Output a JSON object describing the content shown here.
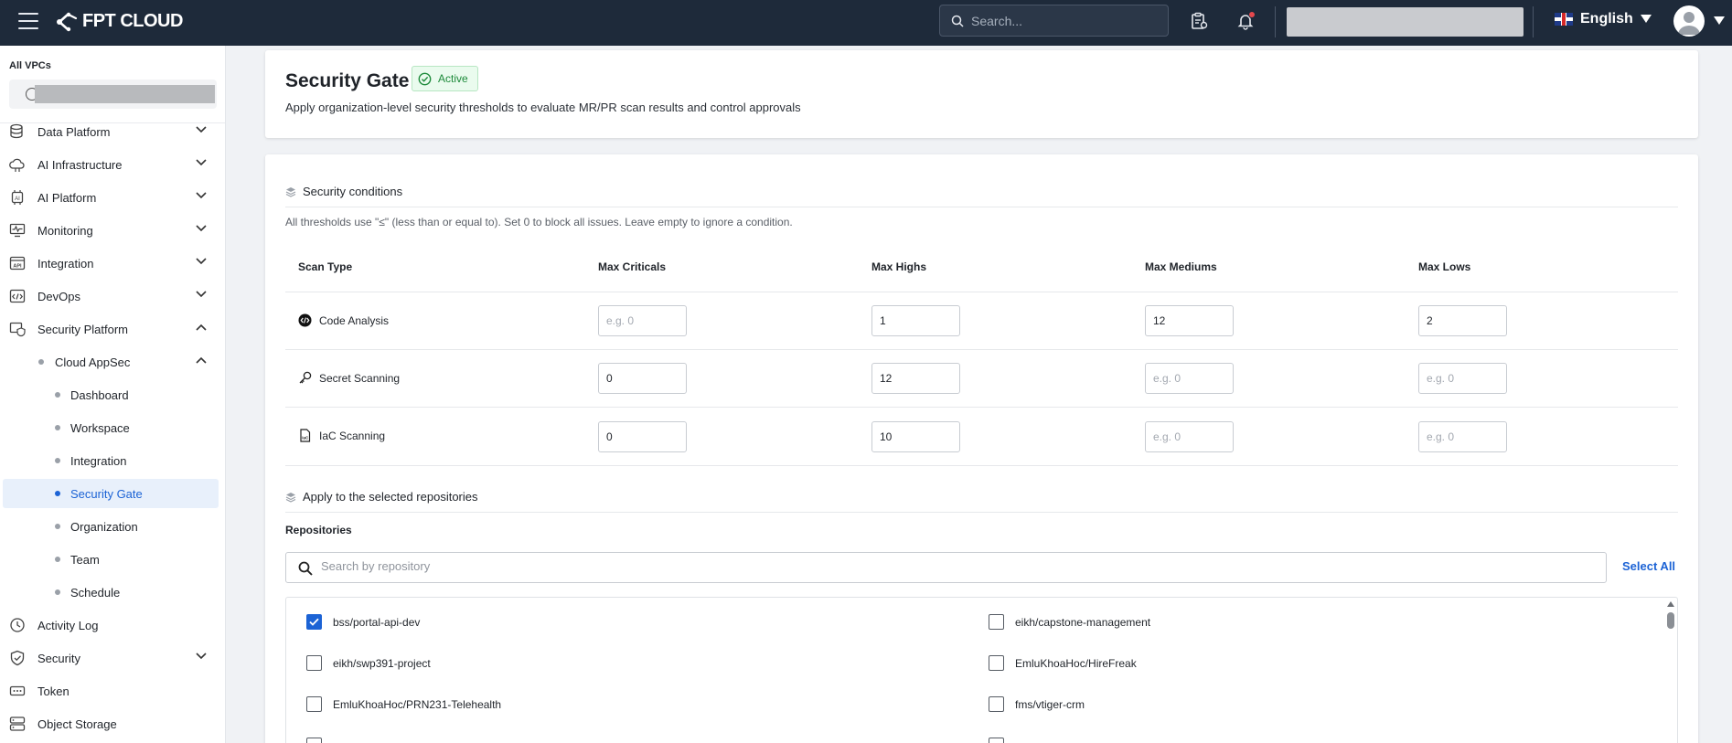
{
  "topbar": {
    "brand": "FPT CLOUD",
    "search_placeholder": "Search...",
    "language": "English"
  },
  "sidebar": {
    "vpc_label": "All VPCs",
    "items": [
      {
        "label": "Data Platform",
        "icon": "database-icon"
      },
      {
        "label": "AI Infrastructure",
        "icon": "cloud-ai-icon"
      },
      {
        "label": "AI Platform",
        "icon": "ai-chip-icon"
      },
      {
        "label": "Monitoring",
        "icon": "monitor-icon"
      },
      {
        "label": "Integration",
        "icon": "api-icon"
      },
      {
        "label": "DevOps",
        "icon": "code-window-icon"
      },
      {
        "label": "Security Platform",
        "icon": "shield-settings-icon"
      }
    ],
    "cloud_appsec": "Cloud AppSec",
    "sub_items": [
      "Dashboard",
      "Workspace",
      "Integration",
      "Security Gate",
      "Organization",
      "Team",
      "Schedule"
    ],
    "bottom_items": [
      {
        "label": "Activity Log",
        "icon": "clock-icon"
      },
      {
        "label": "Security",
        "icon": "shield-check-icon"
      },
      {
        "label": "Token",
        "icon": "token-icon"
      },
      {
        "label": "Object Storage",
        "icon": "storage-icon"
      }
    ]
  },
  "header": {
    "title": "Security Gate",
    "status": "Active",
    "description": "Apply organization-level security thresholds to evaluate MR/PR scan results and control approvals"
  },
  "conditions": {
    "title": "Security conditions",
    "note": "All thresholds use \"≤\" (less than or equal to). Set 0 to block all issues. Leave empty to ignore a condition.",
    "columns": [
      "Scan Type",
      "Max Criticals",
      "Max Highs",
      "Max Mediums",
      "Max Lows"
    ],
    "placeholder": "e.g. 0",
    "rows": [
      {
        "name": "Code Analysis",
        "icon": "code-icon",
        "values": [
          "",
          "1",
          "12",
          "2"
        ]
      },
      {
        "name": "Secret Scanning",
        "icon": "key-icon",
        "values": [
          "0",
          "12",
          "",
          ""
        ]
      },
      {
        "name": "IaC Scanning",
        "icon": "iac-file-icon",
        "values": [
          "0",
          "10",
          "",
          ""
        ]
      }
    ]
  },
  "repositories": {
    "section_title": "Apply to the selected repositories",
    "label": "Repositories",
    "search_placeholder": "Search by repository",
    "select_all": "Select All",
    "items": [
      {
        "name": "bss/portal-api-dev",
        "checked": true
      },
      {
        "name": "eikh/capstone-management",
        "checked": false
      },
      {
        "name": "eikh/swp391-project",
        "checked": false
      },
      {
        "name": "EmluKhoaHoc/HireFreak",
        "checked": false
      },
      {
        "name": "EmluKhoaHoc/PRN231-Telehealth",
        "checked": false
      },
      {
        "name": "fms/vtiger-crm",
        "checked": false
      }
    ]
  }
}
